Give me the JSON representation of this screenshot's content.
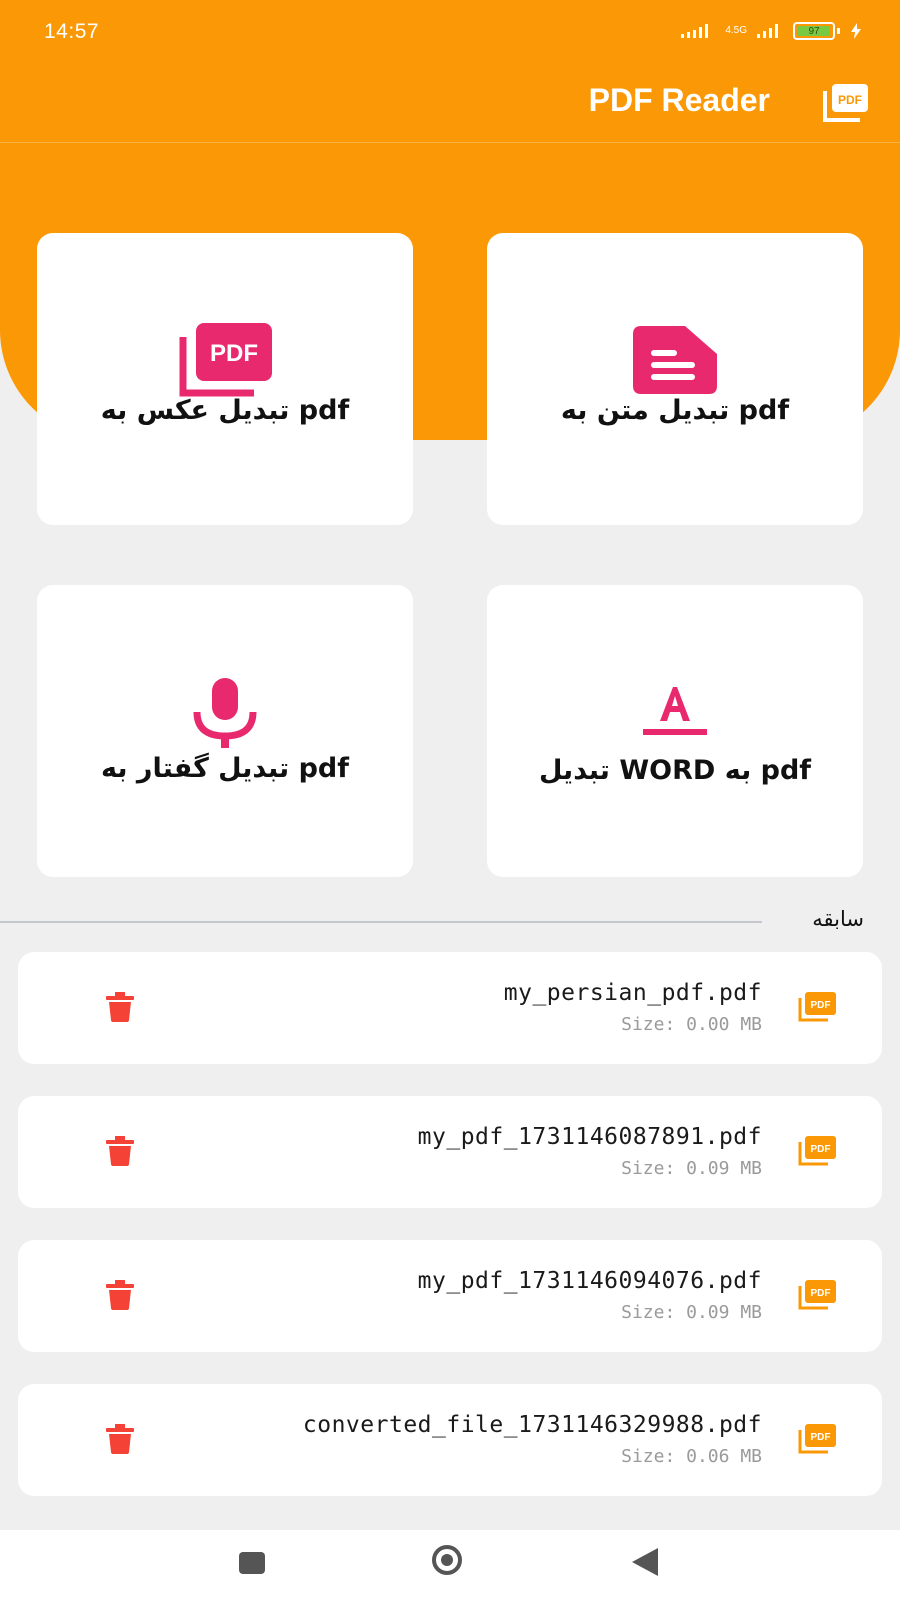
{
  "status_bar": {
    "time": "14:57",
    "network": "4.5G",
    "battery": "97",
    "battery_fraction": 0.97
  },
  "app_bar": {
    "title": "PDF Reader",
    "logo_icon": "pdf-files-icon"
  },
  "colors": {
    "primary": "#fb9805",
    "accent": "#e8296e",
    "delete": "#f44336",
    "background": "#efefef"
  },
  "actions": [
    {
      "id": "text-to-pdf",
      "label": "تبدیل متن به pdf",
      "icon": "document-text-icon"
    },
    {
      "id": "image-to-pdf",
      "label": "تبدیل عکس به pdf",
      "icon": "pdf-files-icon"
    },
    {
      "id": "word-to-pdf",
      "label": "تبدیل WORD به pdf",
      "icon": "text-format-icon"
    },
    {
      "id": "speech-to-pdf",
      "label": "تبدیل گفتار به pdf",
      "icon": "microphone-icon"
    }
  ],
  "history": {
    "title": "سابقه",
    "files": [
      {
        "name": "my_persian_pdf.pdf",
        "size": "Size: 0.00 MB"
      },
      {
        "name": "my_pdf_1731146087891.pdf",
        "size": "Size: 0.09 MB"
      },
      {
        "name": "my_pdf_1731146094076.pdf",
        "size": "Size: 0.09 MB"
      },
      {
        "name": "converted_file_1731146329988.pdf",
        "size": "Size: 0.06 MB"
      }
    ]
  }
}
